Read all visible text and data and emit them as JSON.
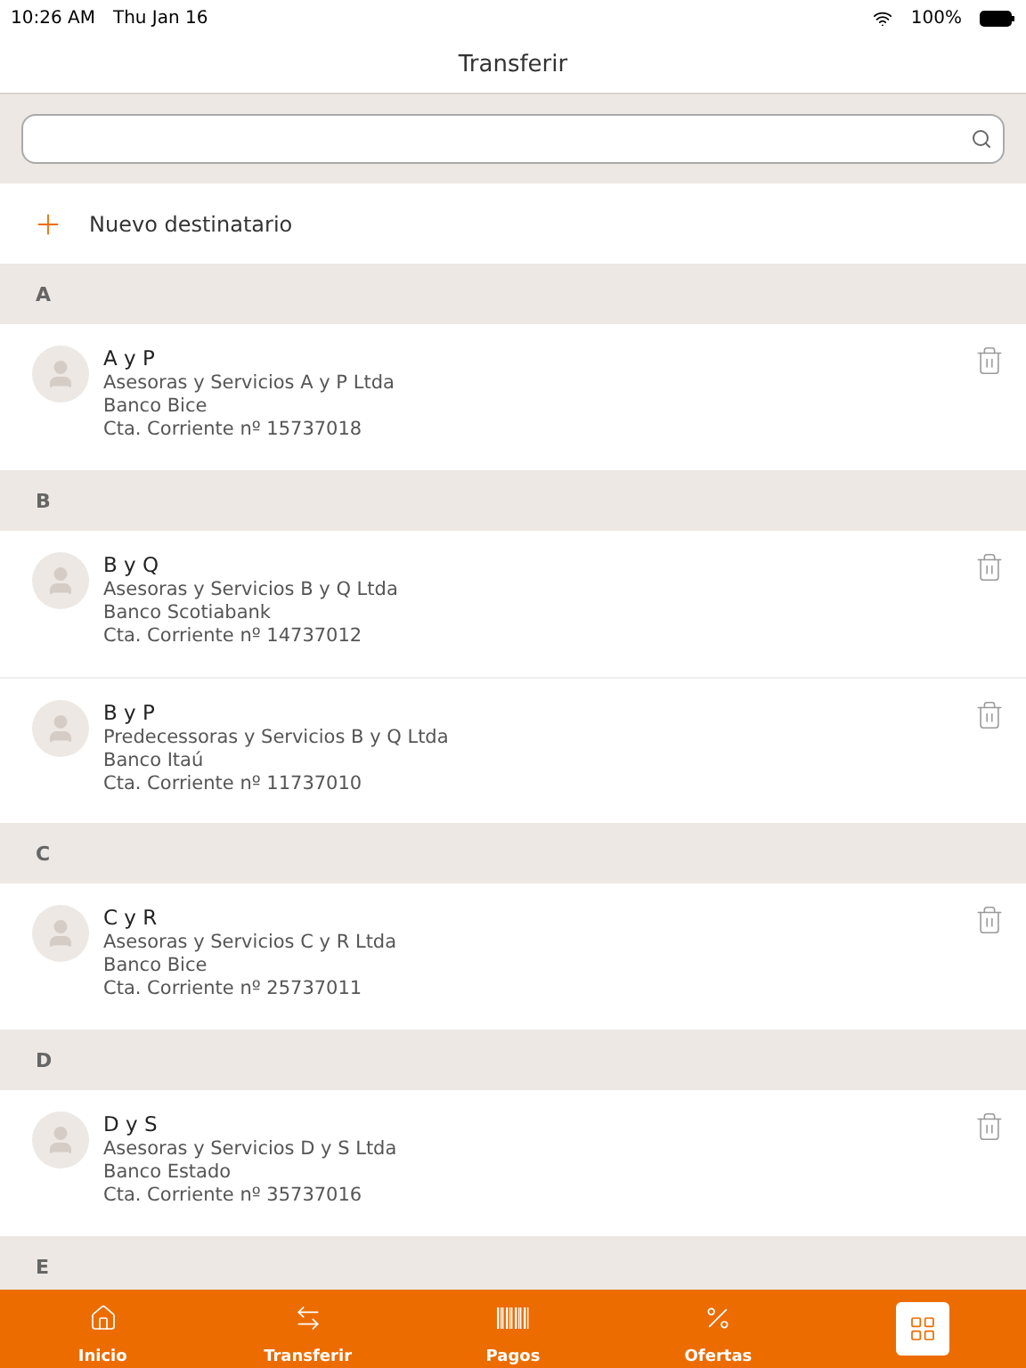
{
  "status_bar": {
    "time": "10:26 AM",
    "date": "Thu Jan 16",
    "battery": "100%"
  },
  "title": "Transferir",
  "new_recipient": "Nuevo destinatario",
  "sections": [
    {
      "letter": "A",
      "contacts": [
        {
          "name": "A y P",
          "company": "Asesoras y Servicios A y P Ltda",
          "bank": "Banco Bice",
          "account": "Cta. Corriente nº 15737018"
        }
      ]
    },
    {
      "letter": "B",
      "contacts": [
        {
          "name": "B y Q",
          "company": "Asesoras y Servicios B y Q Ltda",
          "bank": "Banco Scotiabank",
          "account": "Cta. Corriente nº 14737012"
        },
        {
          "name": "B y P",
          "company": "Predecessoras y Servicios B y Q Ltda",
          "bank": "Banco Itaú",
          "account": "Cta. Corriente nº 11737010"
        }
      ]
    },
    {
      "letter": "C",
      "contacts": [
        {
          "name": "C y R",
          "company": "Asesoras y Servicios C y R Ltda",
          "bank": "Banco Bice",
          "account": "Cta. Corriente nº 25737011"
        }
      ]
    },
    {
      "letter": "D",
      "contacts": [
        {
          "name": "D y S",
          "company": "Asesoras y Servicios D y S Ltda",
          "bank": "Banco Estado",
          "account": "Cta. Corriente nº 35737016"
        }
      ]
    },
    {
      "letter": "E"
    }
  ],
  "tabs": [
    {
      "kind": "home",
      "label": "Inicio",
      "selected": false
    },
    {
      "kind": "transfer",
      "label": "Transferir",
      "selected": false
    },
    {
      "kind": "barcode",
      "label": "Pagos",
      "selected": false
    },
    {
      "kind": "percent",
      "label": "Ofertas",
      "selected": false
    },
    {
      "kind": "grid",
      "selected": true
    }
  ]
}
